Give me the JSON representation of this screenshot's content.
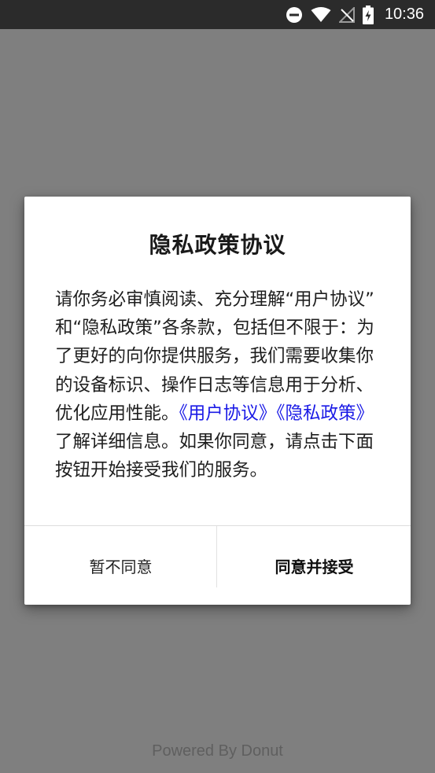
{
  "status_bar": {
    "time": "10:36",
    "icons": [
      "do-not-disturb-icon",
      "wifi-icon",
      "no-signal-icon",
      "battery-charging-icon"
    ]
  },
  "dialog": {
    "title": "隐私政策协议",
    "body_intro": "请你务必审慎阅读、充分理解“用户协议”和“隐私政策”各条款，包括但不限于：为了更好的向你提供服务，我们需要收集你的设备标识、操作日志等信息用于分析、优化应用性能。",
    "link_user_agreement": "《用户协议》",
    "link_privacy_policy": "《隐私政策》",
    "body_outro": "了解详细信息。如果你同意，请点击下面按钮开始接受我们的服务。",
    "decline_label": "暂不同意",
    "accept_label": "同意并接受"
  },
  "footer": {
    "powered_by": "Powered By Donut"
  },
  "colors": {
    "overlay": "#7f7f7f",
    "status_bar": "#2b2b2b",
    "link": "#1a1ae6",
    "dialog_bg": "#ffffff"
  }
}
